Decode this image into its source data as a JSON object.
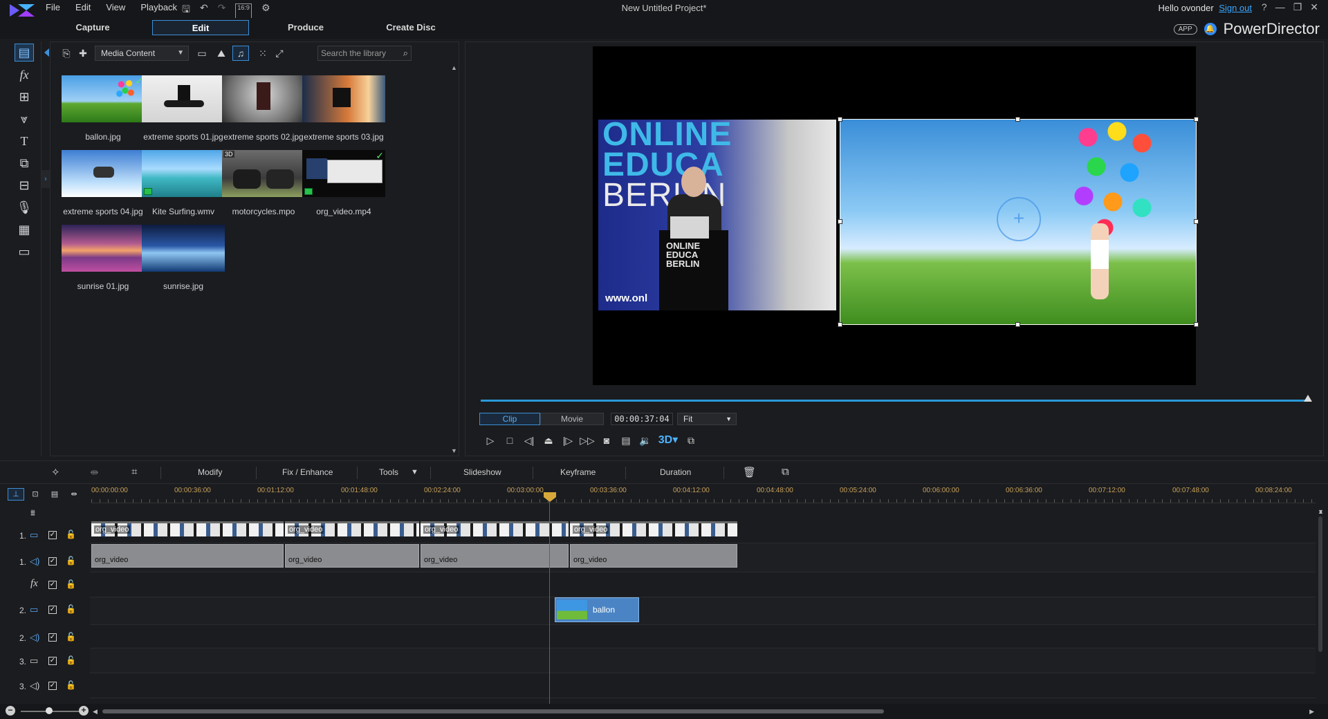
{
  "menu": [
    "File",
    "Edit",
    "View",
    "Playback"
  ],
  "toolbar": {
    "ratio": "16:9"
  },
  "window_title": "New Untitled Project*",
  "user": {
    "greeting": "Hello ovonder",
    "signout": "Sign out"
  },
  "window_controls": [
    "?",
    "—",
    "❐",
    "✕"
  ],
  "modes": {
    "capture": "Capture",
    "edit": "Edit",
    "produce": "Produce",
    "create_disc": "Create Disc"
  },
  "brand": {
    "app_pill": "APP",
    "name": "PowerDirector"
  },
  "library": {
    "content_filter": "Media Content",
    "search_placeholder": "Search the library",
    "items": [
      {
        "label": "ballon.jpg",
        "checked": true
      },
      {
        "label": "extreme sports 01.jpg"
      },
      {
        "label": "extreme sports 02.jpg"
      },
      {
        "label": "extreme sports 03.jpg"
      },
      {
        "label": "extreme sports 04.jpg"
      },
      {
        "label": "Kite Surfing.wmv"
      },
      {
        "label": "motorcycles.mpo",
        "badge": "3D"
      },
      {
        "label": "org_video.mp4",
        "checked": true
      },
      {
        "label": "sunrise 01.jpg"
      },
      {
        "label": "sunrise.jpg"
      }
    ]
  },
  "preview": {
    "clip_text": {
      "l1": "ONLINE",
      "l2": "EDUCA",
      "l3": "BERLIN",
      "podium": "ONLINE\nEDUCA\nBERLIN",
      "url": "www.onl"
    },
    "mode_clip": "Clip",
    "mode_movie": "Movie",
    "timecode": "00:00:37:04",
    "zoom": "Fit",
    "progress": 1.0
  },
  "edit_toolbar": {
    "modify": "Modify",
    "fix_enhance": "Fix / Enhance",
    "tools": "Tools",
    "slideshow": "Slideshow",
    "keyframe": "Keyframe",
    "duration": "Duration"
  },
  "timeline": {
    "ruler": [
      "00:00:00:00",
      "00:00:36:00",
      "00:01:12:00",
      "00:01:48:00",
      "00:02:24:00",
      "00:03:00:00",
      "00:03:36:00",
      "00:04:12:00",
      "00:04:48:00",
      "00:05:24:00",
      "00:06:00:00",
      "00:06:36:00",
      "00:07:12:00",
      "00:07:48:00",
      "00:08:24:00"
    ],
    "tracks": [
      {
        "num": "1.",
        "type": "video"
      },
      {
        "num": "1.",
        "type": "audio"
      },
      {
        "num": "",
        "type": "fx"
      },
      {
        "num": "2.",
        "type": "video"
      },
      {
        "num": "2.",
        "type": "audio"
      },
      {
        "num": "3.",
        "type": "video"
      },
      {
        "num": "3.",
        "type": "audio"
      }
    ],
    "video_clip_label": "org_video",
    "audio_clip_label": "org_video",
    "pip_clip_label": "ballon"
  },
  "colors": {
    "accent": "#3d8fd8",
    "playhead": "#d4303a",
    "ruler_text": "#c8a25a",
    "bg": "#1b1c1f"
  }
}
